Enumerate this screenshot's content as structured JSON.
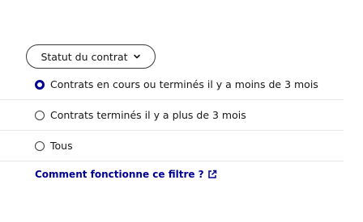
{
  "filter": {
    "label": "Statut du contrat",
    "icon": "chevron-down-icon"
  },
  "options": [
    {
      "label": "Contrats en cours ou terminés il y a moins de 3 mois",
      "selected": true
    },
    {
      "label": "Contrats terminés il y a plus de 3 mois",
      "selected": false
    },
    {
      "label": "Tous",
      "selected": false
    }
  ],
  "help_link": {
    "label": "Comment fonctionne ce filtre ?",
    "icon": "external-link-icon"
  },
  "colors": {
    "accent": "#000091",
    "text": "#161616",
    "border": "#3a3a3a",
    "divider": "#e7e7e7"
  }
}
